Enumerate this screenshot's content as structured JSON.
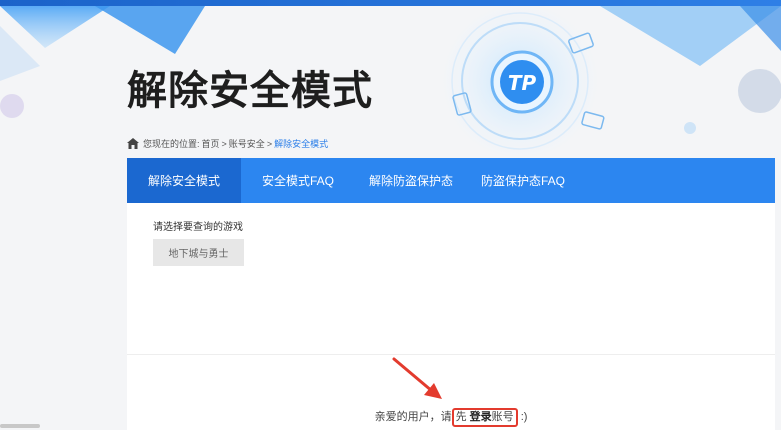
{
  "header": {
    "title": "解除安全模式",
    "logo_text": "TP"
  },
  "breadcrumb": {
    "prefix": "您现在的位置:",
    "items": [
      "首页",
      "账号安全",
      "解除安全模式"
    ],
    "separator": ">"
  },
  "tabs": [
    {
      "label": "解除安全模式",
      "active": true
    },
    {
      "label": "安全模式FAQ",
      "active": false
    },
    {
      "label": "解除防盗保护态",
      "active": false
    },
    {
      "label": "防盗保护态FAQ",
      "active": false
    }
  ],
  "game_select": {
    "label": "请选择要查询的游戏",
    "option": "地下城与勇士"
  },
  "login_prompt": {
    "before": "亲爱的用户，请",
    "boxed_pre": "先 ",
    "link": "登录",
    "boxed_post": "账号",
    "after": " :)"
  },
  "colors": {
    "tab_bar": "#2c86f0",
    "tab_active": "#1b68d0",
    "annotation": "#e33b2e"
  }
}
